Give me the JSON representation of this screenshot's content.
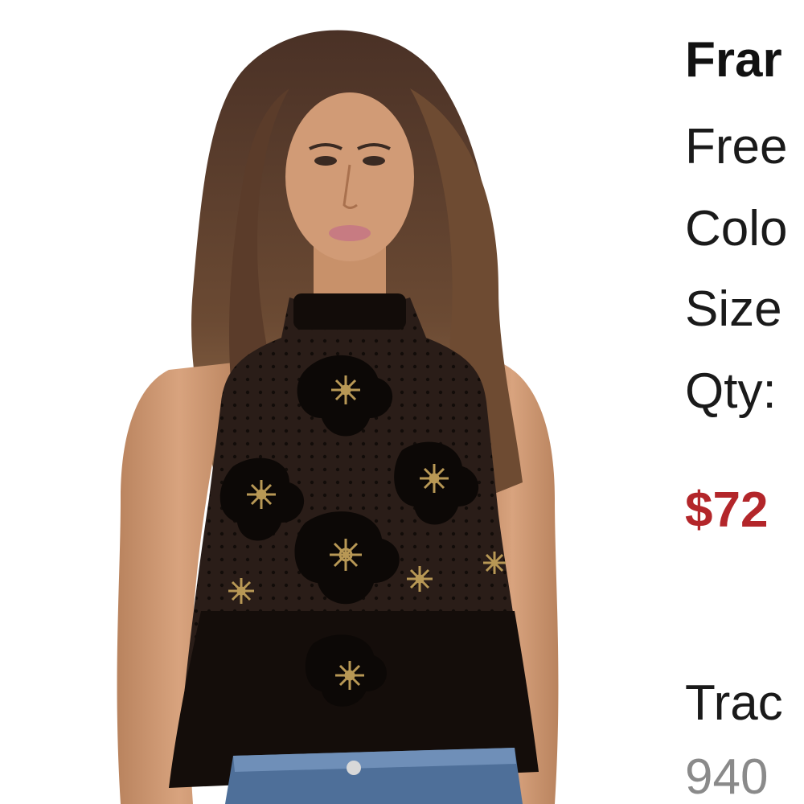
{
  "product": {
    "image_alt": "Model wearing black sleeveless lace top with gold floral embroidery",
    "name": "Frar",
    "brand": "Free",
    "color_label": "Colo",
    "size_label": "Size",
    "qty_label": "Qty:",
    "price": "$72",
    "tracking_label": "Trac",
    "tracking_number": "940"
  },
  "colors": {
    "price": "#b3262a",
    "text": "#1a1a1a",
    "muted": "#8a8a8a",
    "background": "#ffffff"
  }
}
